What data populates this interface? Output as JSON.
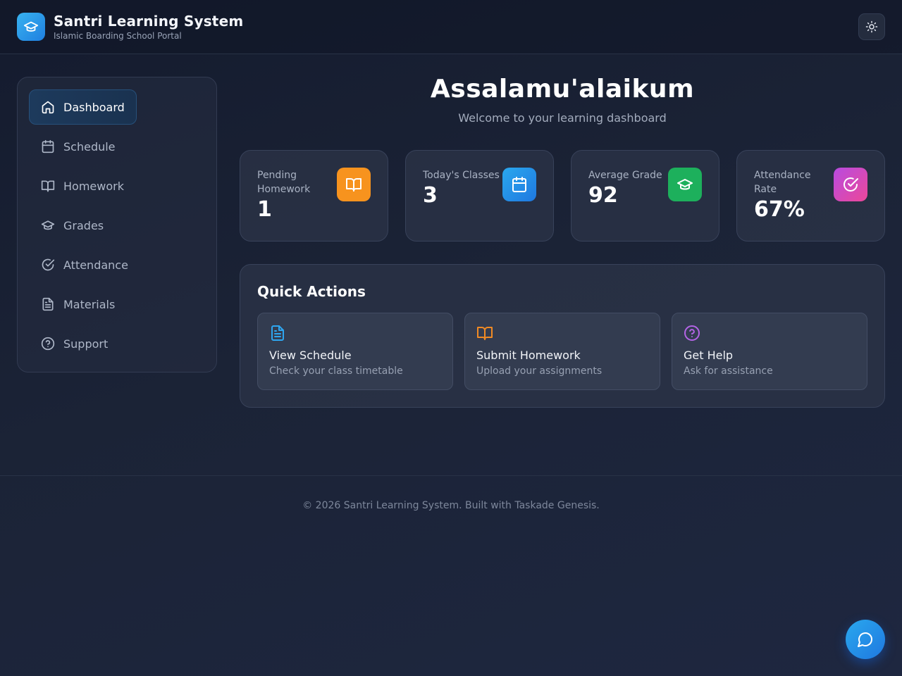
{
  "header": {
    "title": "Santri Learning System",
    "subtitle": "Islamic Boarding School Portal",
    "logo_icon": "graduation-cap-icon",
    "theme_toggle_icon": "sun-icon"
  },
  "sidebar": {
    "items": [
      {
        "label": "Dashboard",
        "icon": "home-icon",
        "active": true
      },
      {
        "label": "Schedule",
        "icon": "calendar-icon",
        "active": false
      },
      {
        "label": "Homework",
        "icon": "book-open-icon",
        "active": false
      },
      {
        "label": "Grades",
        "icon": "graduation-cap-icon",
        "active": false
      },
      {
        "label": "Attendance",
        "icon": "check-circle-icon",
        "active": false
      },
      {
        "label": "Materials",
        "icon": "file-text-icon",
        "active": false
      },
      {
        "label": "Support",
        "icon": "help-circle-icon",
        "active": false
      }
    ]
  },
  "main": {
    "greeting": "Assalamu'alaikum",
    "welcome": "Welcome to your learning dashboard",
    "stats": [
      {
        "label": "Pending Homework",
        "value": "1",
        "icon": "book-open-icon",
        "color": "#f7931e"
      },
      {
        "label": "Today's Classes",
        "value": "3",
        "icon": "calendar-icon",
        "color": "#2196f3"
      },
      {
        "label": "Average Grade",
        "value": "92",
        "icon": "graduation-cap-icon",
        "color": "#1db05c"
      },
      {
        "label": "Attendance Rate",
        "value": "67%",
        "icon": "check-circle-icon",
        "color": "#d046c8"
      }
    ],
    "quick_actions": {
      "title": "Quick Actions",
      "items": [
        {
          "title": "View Schedule",
          "description": "Check your class timetable",
          "icon": "file-text-icon",
          "color": "#2ea6f0"
        },
        {
          "title": "Submit Homework",
          "description": "Upload your assignments",
          "icon": "book-open-icon",
          "color": "#f08a24"
        },
        {
          "title": "Get Help",
          "description": "Ask for assistance",
          "icon": "help-circle-icon",
          "color": "#b464e6"
        }
      ]
    }
  },
  "footer": {
    "text": "© 2026 Santri Learning System. Built with Taskade Genesis."
  },
  "chat": {
    "icon": "message-circle-icon"
  }
}
